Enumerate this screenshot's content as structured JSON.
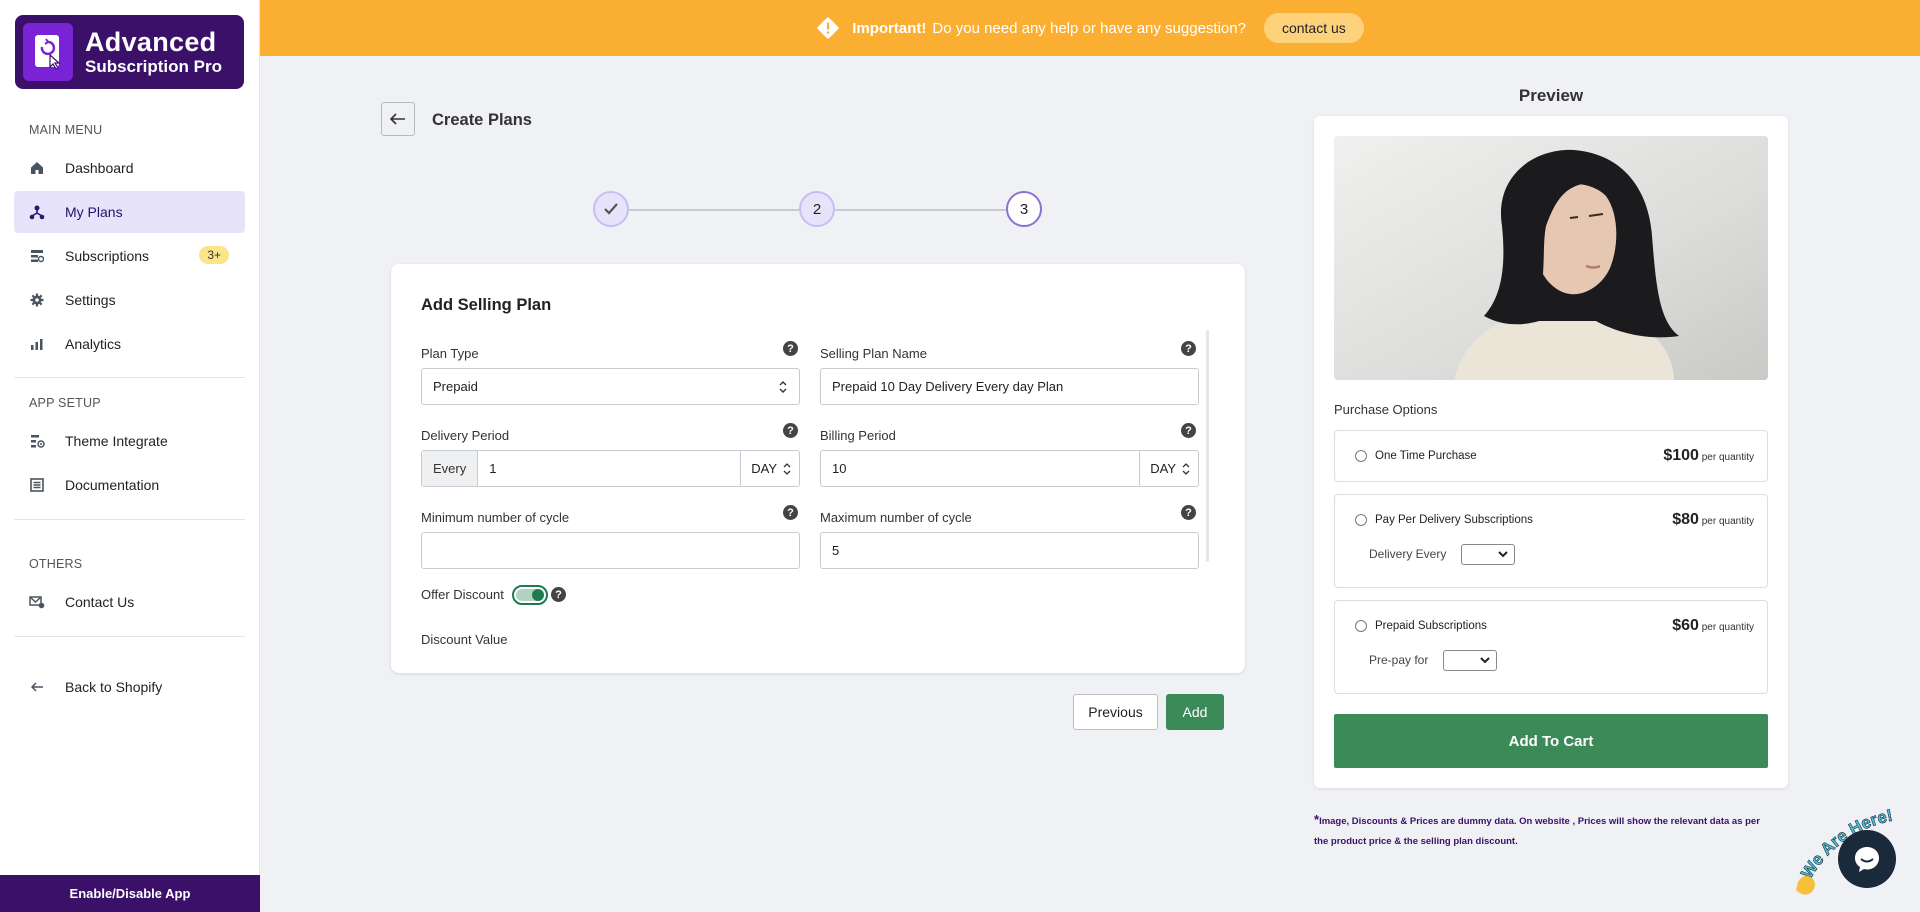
{
  "app": {
    "logo_line1": "Advanced",
    "logo_line2": "Subscription Pro"
  },
  "sidebar": {
    "main_menu_title": "MAIN MENU",
    "main_items": [
      {
        "label": "Dashboard",
        "icon": "home-icon"
      },
      {
        "label": "My Plans",
        "icon": "plans-icon",
        "active": true
      },
      {
        "label": "Subscriptions",
        "icon": "subscriptions-icon",
        "badge": "3+"
      },
      {
        "label": "Settings",
        "icon": "gear-icon"
      },
      {
        "label": "Analytics",
        "icon": "bar-chart-icon"
      }
    ],
    "app_setup_title": "APP SETUP",
    "setup_items": [
      {
        "label": "Theme Integrate",
        "icon": "theme-integrate-icon"
      },
      {
        "label": "Documentation",
        "icon": "documentation-icon"
      }
    ],
    "others_title": "OTHERS",
    "other_items": [
      {
        "label": "Contact Us",
        "icon": "mail-icon"
      }
    ],
    "back_label": "Back to Shopify",
    "enable_label": "Enable/Disable App"
  },
  "banner": {
    "important": "Important!",
    "message": "Do you need any help or have any suggestion?",
    "contact_label": "contact us"
  },
  "header": {
    "title": "Create Plans"
  },
  "stepper": {
    "steps": [
      "✓",
      "2",
      "3"
    ],
    "current": 3
  },
  "form": {
    "title": "Add Selling Plan",
    "plan_type_label": "Plan Type",
    "plan_type_value": "Prepaid",
    "selling_plan_name_label": "Selling Plan Name",
    "selling_plan_name_value": "Prepaid 10 Day Delivery Every day Plan",
    "delivery_period_label": "Delivery Period",
    "delivery_prefix": "Every",
    "delivery_value": "1",
    "delivery_unit": "DAY",
    "billing_period_label": "Billing Period",
    "billing_value": "10",
    "billing_unit": "DAY",
    "min_cycle_label": "Minimum number of cycle",
    "min_cycle_value": "",
    "max_cycle_label": "Maximum number of cycle",
    "max_cycle_value": "5",
    "offer_discount_label": "Offer Discount",
    "offer_discount_on": true,
    "discount_value_label": "Discount Value",
    "help_glyph": "?"
  },
  "actions": {
    "previous_label": "Previous",
    "add_label": "Add"
  },
  "preview": {
    "title": "Preview",
    "purchase_options_title": "Purchase Options",
    "options": [
      {
        "name": "One Time Purchase",
        "price": "$100",
        "per": "per quantity"
      },
      {
        "name": "Pay Per Delivery Subscriptions",
        "price": "$80",
        "per": "per quantity",
        "sub_label": "Delivery Every"
      },
      {
        "name": "Prepaid Subscriptions",
        "price": "$60",
        "per": "per quantity",
        "sub_label": "Pre-pay for"
      }
    ],
    "cart_label": "Add To Cart",
    "note_star": "*",
    "note": "Image, Discounts & Prices are dummy data. On website , Prices will show the relevant data as per the product price & the selling plan discount."
  },
  "chat": {
    "wave_text": "We Are Here!"
  },
  "colors": {
    "brand": "#3b1069",
    "banner": "#fbaf32",
    "accent_green": "#3b8a58",
    "active_nav": "#e6e3fa"
  }
}
